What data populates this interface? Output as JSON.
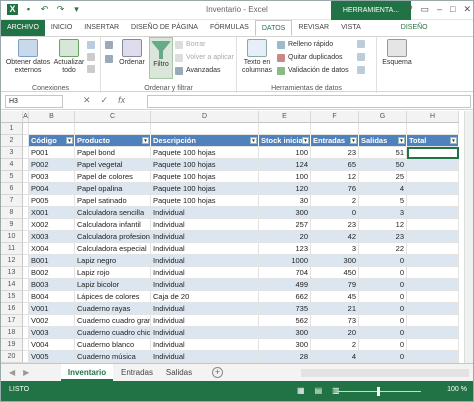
{
  "window": {
    "title": "Inventario - Excel",
    "context_tab": "HERRAMIENTA...",
    "buttons": [
      "?",
      "▭",
      "–",
      "□",
      "✕"
    ]
  },
  "tabs": [
    "ARCHIVO",
    "INICIO",
    "INSERTAR",
    "DISEÑO DE PÁGINA",
    "FÓRMULAS",
    "DATOS",
    "REVISAR",
    "VISTA",
    "DISEÑO"
  ],
  "active_tab": "DATOS",
  "ribbon": {
    "external": "Obtener datos externos",
    "refresh": "Actualizar todo",
    "connections_group": "Conexiones",
    "sort": "Ordenar",
    "filter": "Filtro",
    "clear": "Borrar",
    "reapply": "Volver a aplicar",
    "advanced": "Avanzadas",
    "sort_group": "Ordenar y filtrar",
    "text_to_cols": "Texto en columnas",
    "flash_fill": "Relleno rápido",
    "remove_dup": "Quitar duplicados",
    "validation": "Validación de datos",
    "tools_group": "Herramientas de datos",
    "outline": "Esquema"
  },
  "formula_bar": {
    "name_box": "H3",
    "value": ""
  },
  "columns": [
    "A",
    "B",
    "C",
    "D",
    "E",
    "F",
    "G",
    "H"
  ],
  "table": {
    "headers": [
      "Código",
      "Producto",
      "Descripción",
      "Stock inicial",
      "Entradas",
      "Salidas",
      "Total"
    ],
    "rows": [
      [
        "P001",
        "Papel bond",
        "Paquete 100 hojas",
        "100",
        "23",
        "51",
        ""
      ],
      [
        "P002",
        "Papel vegetal",
        "Paquete 100 hojas",
        "124",
        "65",
        "50",
        ""
      ],
      [
        "P003",
        "Papel de colores",
        "Paquete 100 hojas",
        "100",
        "12",
        "25",
        ""
      ],
      [
        "P004",
        "Papel opalina",
        "Paquete 100 hojas",
        "120",
        "76",
        "4",
        ""
      ],
      [
        "P005",
        "Papel satinado",
        "Paquete 100 hojas",
        "30",
        "2",
        "5",
        ""
      ],
      [
        "X001",
        "Calculadora sencilla",
        "Individual",
        "300",
        "0",
        "3",
        ""
      ],
      [
        "X002",
        "Calculadora infantil",
        "Individual",
        "257",
        "23",
        "12",
        ""
      ],
      [
        "X003",
        "Calculadora profesional",
        "Individual",
        "20",
        "42",
        "23",
        ""
      ],
      [
        "X004",
        "Calculadora especial",
        "Individual",
        "123",
        "3",
        "22",
        ""
      ],
      [
        "B001",
        "Lapiz negro",
        "Individual",
        "1000",
        "300",
        "0",
        ""
      ],
      [
        "B002",
        "Lapiz rojo",
        "Individual",
        "704",
        "450",
        "0",
        ""
      ],
      [
        "B003",
        "Lapiz bicolor",
        "Individual",
        "499",
        "79",
        "0",
        ""
      ],
      [
        "B004",
        "Lápices de colores",
        "Caja de 20",
        "662",
        "45",
        "0",
        ""
      ],
      [
        "V001",
        "Cuaderno rayas",
        "Individual",
        "735",
        "21",
        "0",
        ""
      ],
      [
        "V002",
        "Cuaderno cuadro grande",
        "Individual",
        "562",
        "73",
        "0",
        ""
      ],
      [
        "V003",
        "Cuaderno cuadro chico",
        "Individual",
        "300",
        "20",
        "0",
        ""
      ],
      [
        "V004",
        "Cuaderno blanco",
        "Individual",
        "300",
        "2",
        "0",
        ""
      ],
      [
        "V005",
        "Cuaderno música",
        "Individual",
        "28",
        "4",
        "0",
        ""
      ]
    ]
  },
  "row_numbers": [
    "1",
    "2",
    "3",
    "4",
    "5",
    "6",
    "7",
    "8",
    "9",
    "10",
    "11",
    "12",
    "13",
    "14",
    "15",
    "16",
    "17",
    "18",
    "19",
    "20",
    "21"
  ],
  "sheets": [
    "Inventario",
    "Entradas",
    "Salidas"
  ],
  "active_sheet": "Inventario",
  "status": {
    "text": "LISTO",
    "zoom": "100 %"
  },
  "colors": {
    "excel_green": "#217346",
    "table_header": "#4f81bd",
    "table_band": "#dce6f1"
  }
}
